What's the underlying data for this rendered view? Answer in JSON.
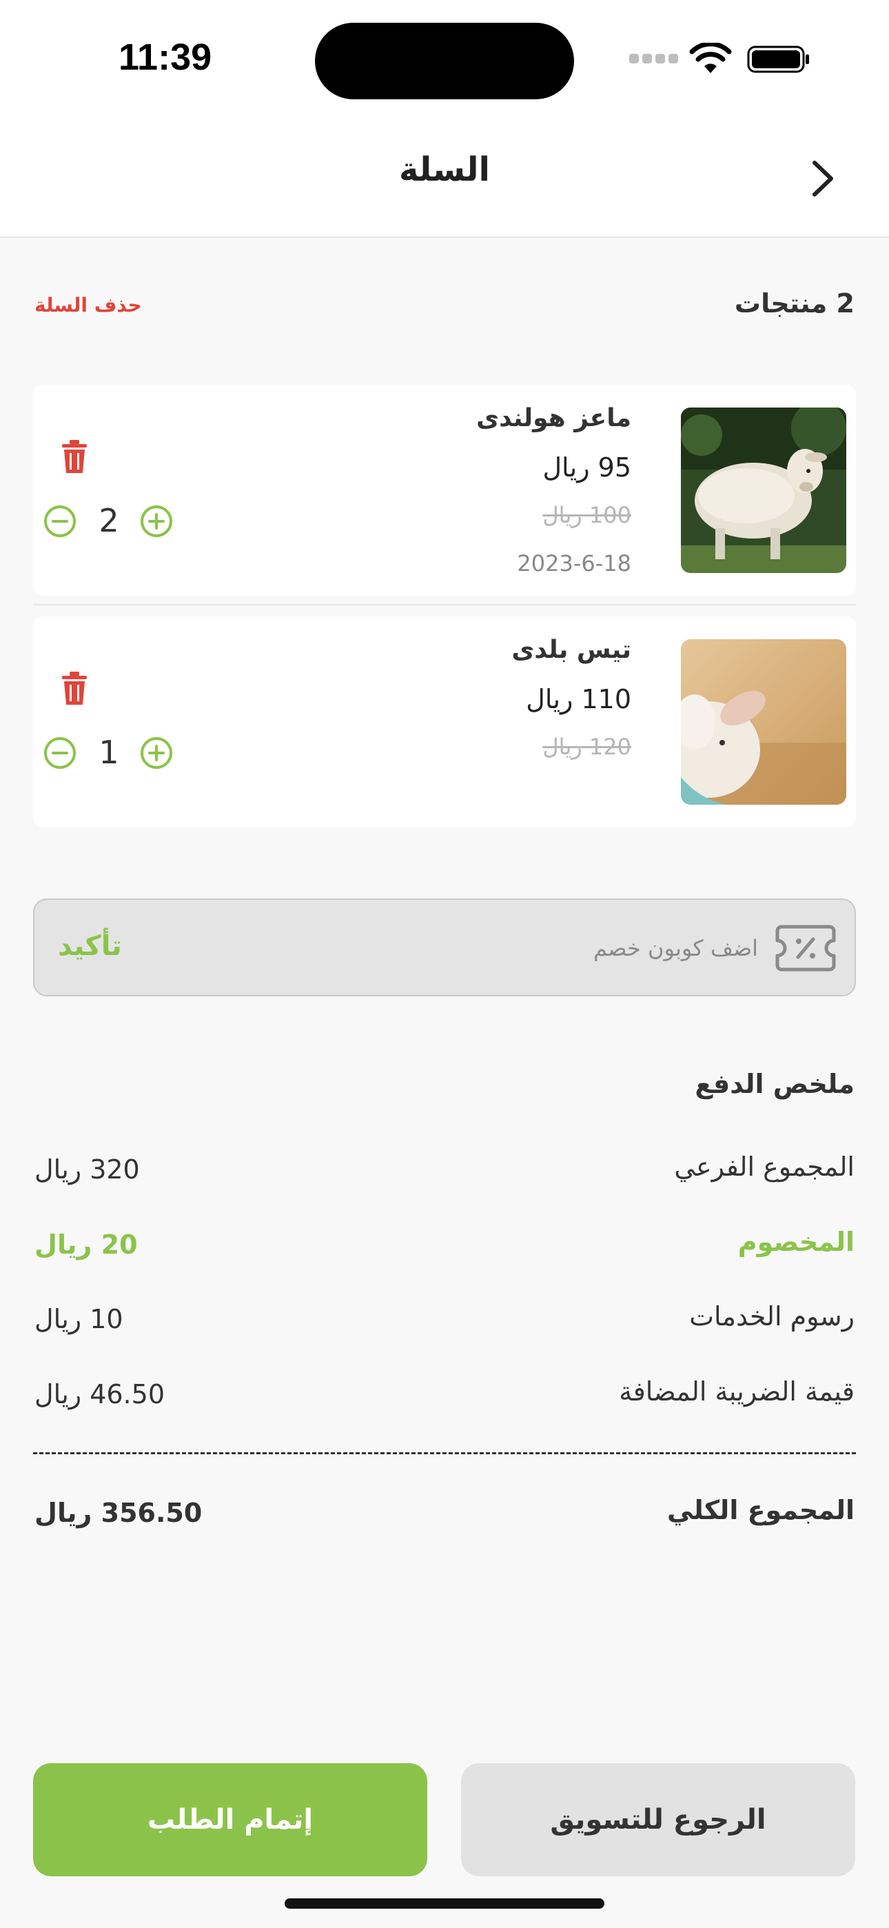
{
  "status_bar": {
    "time": "11:39"
  },
  "header": {
    "title": "السلة"
  },
  "cart": {
    "count_label": "2 منتجات",
    "clear_label": "حذف السلة",
    "items": [
      {
        "name": "ماعز هولندى",
        "price": "95 ريال",
        "old_price": "100 ريال",
        "date": "2023-6-18",
        "quantity": "2",
        "image": "sheep-photo"
      },
      {
        "name": "تيس بلدى",
        "price": "110 ريال",
        "old_price": "120 ريال",
        "quantity": "1",
        "image": "lamb-photo"
      }
    ]
  },
  "coupon": {
    "placeholder": "اضف كوبون خصم",
    "value": "",
    "confirm_label": "تأكيد"
  },
  "summary": {
    "title": "ملخص الدفع",
    "subtotal_label": "المجموع الفرعي",
    "subtotal_value": "320 ريال",
    "discount_label": "المخصوم",
    "discount_value": "20 ريال",
    "service_label": "رسوم الخدمات",
    "service_value": "10 ريال",
    "vat_label": "قيمة الضريبة المضافة",
    "vat_value": "46.50 ريال",
    "total_label": "المجموع الكلي",
    "total_value": "356.50 ريال"
  },
  "actions": {
    "checkout_label": "إتمام الطلب",
    "continue_label": "الرجوع للتسويق"
  },
  "colors": {
    "accent": "#8bc34a",
    "danger": "#e0453a",
    "background": "#f8f8f8"
  }
}
